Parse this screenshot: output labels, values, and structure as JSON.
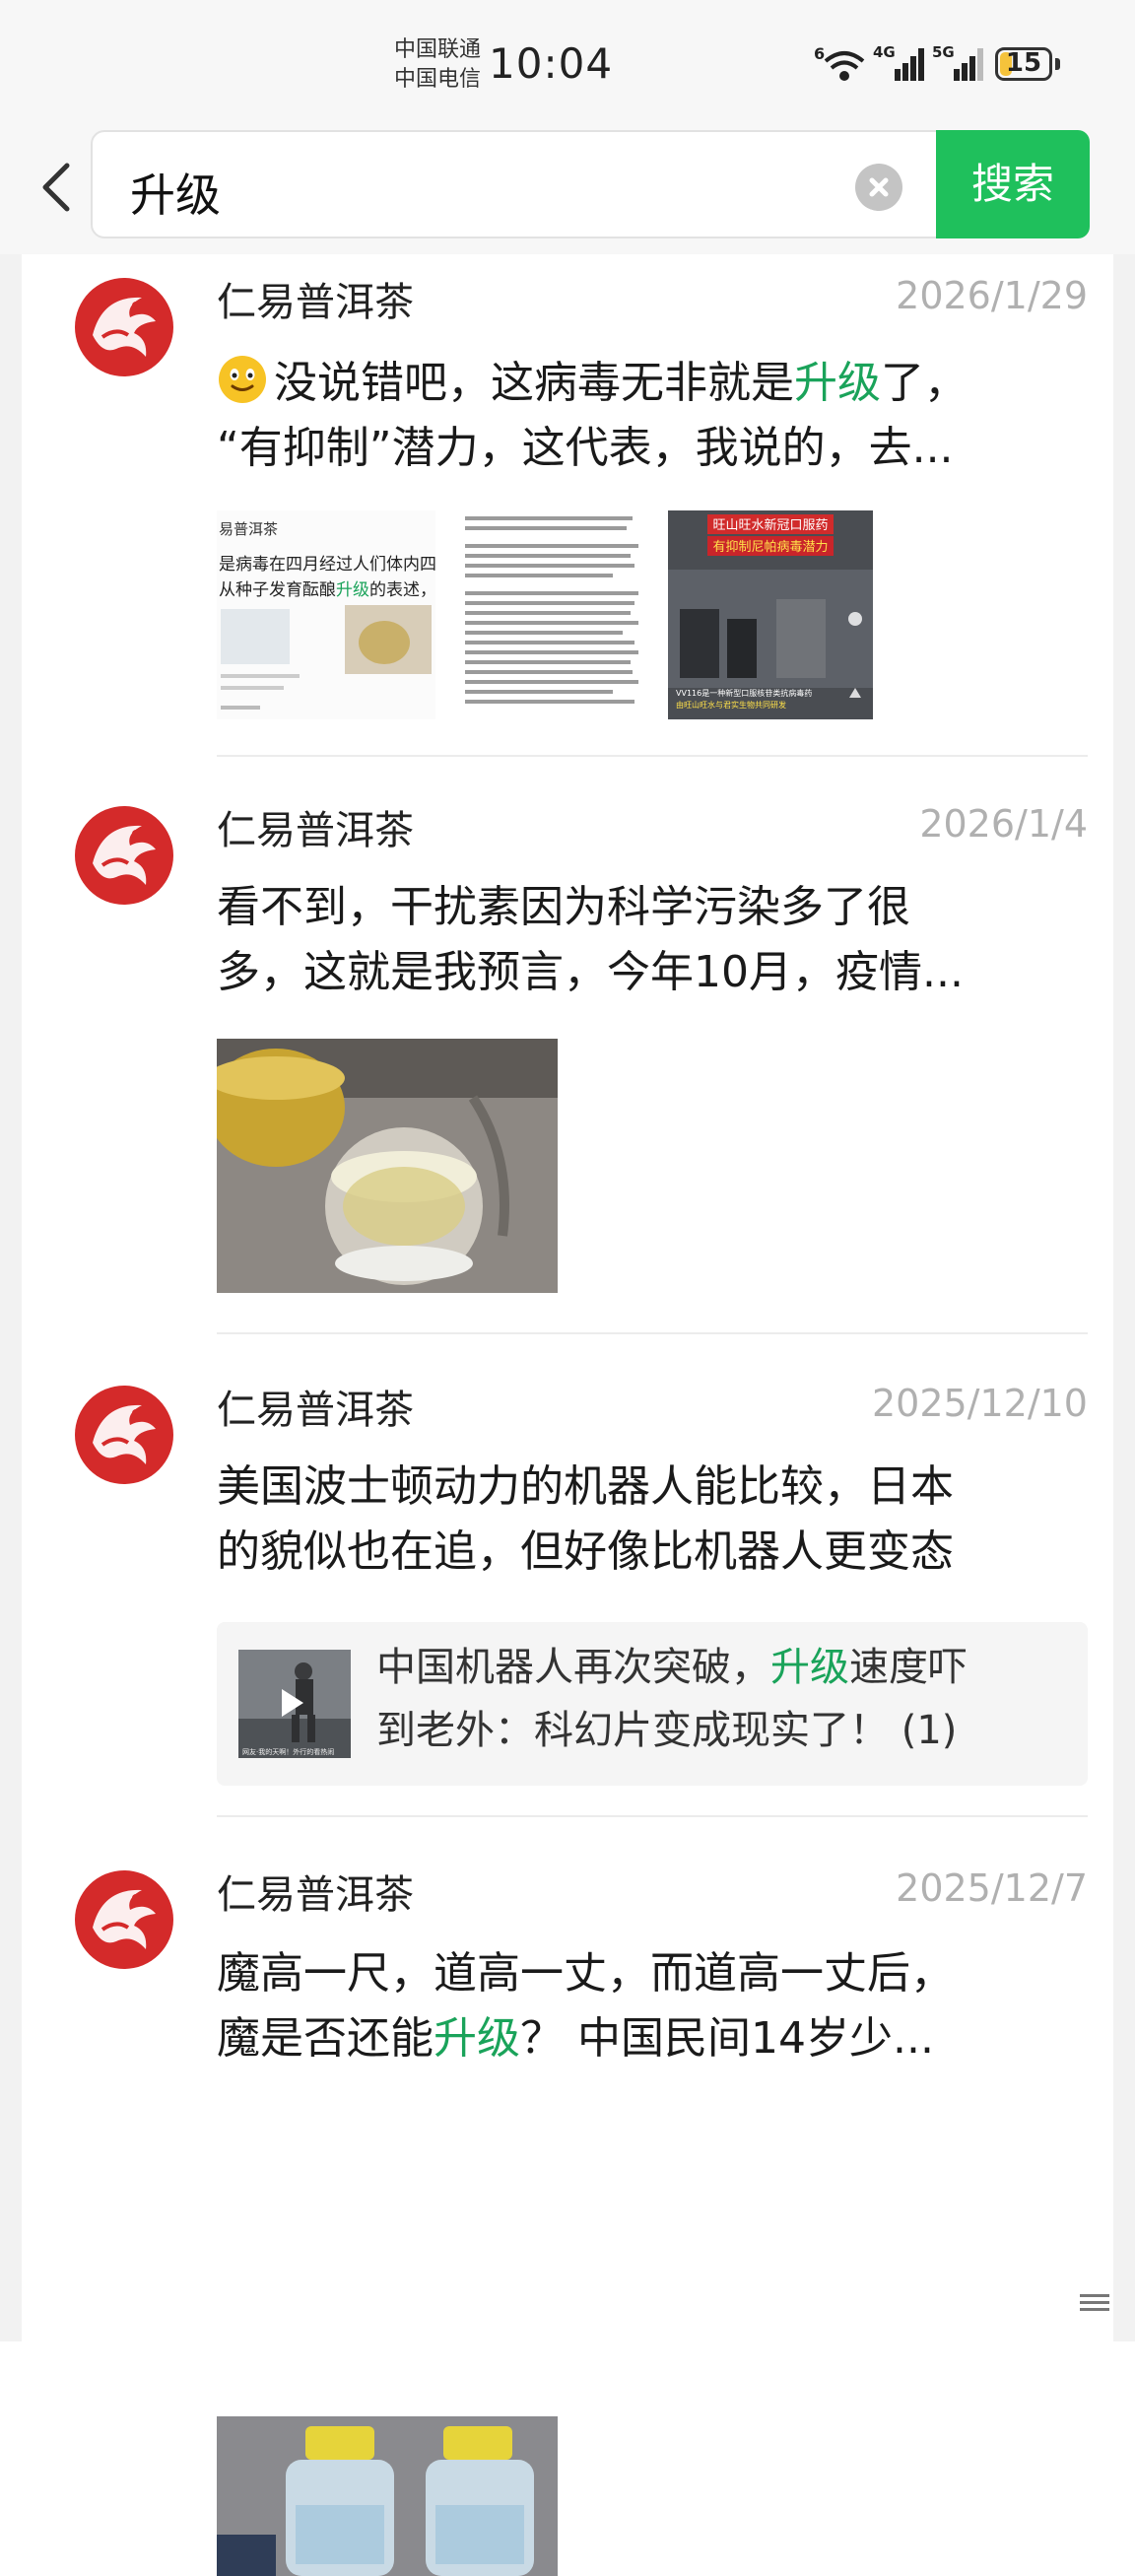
{
  "status_bar": {
    "carrier_1": "中国联通",
    "carrier_2": "中国电信",
    "time": "10:04",
    "wifi_label": "6",
    "signal_1_label": "4G",
    "signal_2_label": "5G",
    "battery_percent": "15",
    "battery_color": "#f5c33b"
  },
  "search": {
    "query": "升级",
    "button_label": "搜索",
    "accent_color": "#1fc05c"
  },
  "posts": [
    {
      "author": "仁易普洱茶",
      "date": "2026/1/29",
      "line1_pre": "没说错吧，这病毒无非就是",
      "line1_hl": "升级",
      "line1_post": "了，",
      "line2": "“有抑制”潜力，这代表，我说的，去...",
      "img1_line1": "易普洱茶",
      "img1_line2": "是病毒在四月经过人们体内四",
      "img1_line3_pre": "从种子发育酝酿",
      "img1_line3_hl": "升级",
      "img1_line3_post": "的表述，",
      "img3_banner1": "旺山旺水新冠口服药",
      "img3_banner2": "有抑制尼帕病毒潜力",
      "img3_caption1": "VV116是一种新型口服核苷类抗病毒药",
      "img3_caption2": "由旺山旺水与君实生物共同研发"
    },
    {
      "author": "仁易普洱茶",
      "date": "2026/1/4",
      "line1": "看不到，干扰素因为科学污染多了很",
      "line2": "多，这就是我预言，今年10月，疫情..."
    },
    {
      "author": "仁易普洱茶",
      "date": "2025/12/10",
      "line1": "美国波士顿动力的机器人能比较，日本",
      "line2": "的貌似也在追，但好像比机器人更变态",
      "link_line1_pre": "中国机器人再次突破，",
      "link_line1_hl": "升级",
      "link_line1_post": "速度吓",
      "link_line2": "到老外：科幻片变成现实了！ (1)",
      "link_thumb_caption": "网友·我的天啊！外行的看热闹"
    },
    {
      "author": "仁易普洱茶",
      "date": "2025/12/7",
      "line1": "魔高一尺，道高一丈，而道高一丈后，",
      "line2_pre": "魔是否还能",
      "line2_hl": "升级",
      "line2_post": "？  中国民间14岁少..."
    }
  ],
  "highlight_color": "#1aa35a"
}
